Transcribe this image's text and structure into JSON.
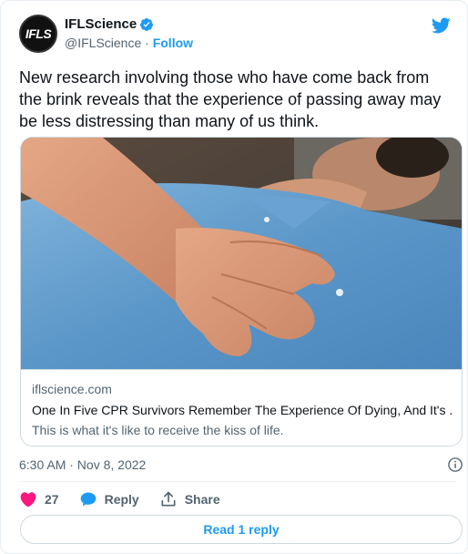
{
  "account": {
    "avatar_text": "IFLS",
    "name": "IFLScience",
    "handle": "@IFLScience",
    "separator": " · ",
    "follow_label": "Follow",
    "verified": true
  },
  "tweet": {
    "text": "New research involving those who have come back from the brink reveals that the experience of passing away may be less distressing than many of us think."
  },
  "card": {
    "image_icon": "cpr-photo",
    "domain": "iflscience.com",
    "title": "One In Five CPR Survivors Remember The Experience Of Dying, And It's ...",
    "description": "This is what it's like to receive the kiss of life."
  },
  "meta": {
    "timestamp": "6:30 AM · Nov 8, 2022"
  },
  "actions": {
    "like_count": "27",
    "reply_label": "Reply",
    "share_label": "Share"
  },
  "read_replies_label": "Read 1 reply",
  "colors": {
    "accent": "#1d9bf0",
    "like": "#f91880",
    "text": "#0f1419",
    "secondary": "#536471"
  }
}
